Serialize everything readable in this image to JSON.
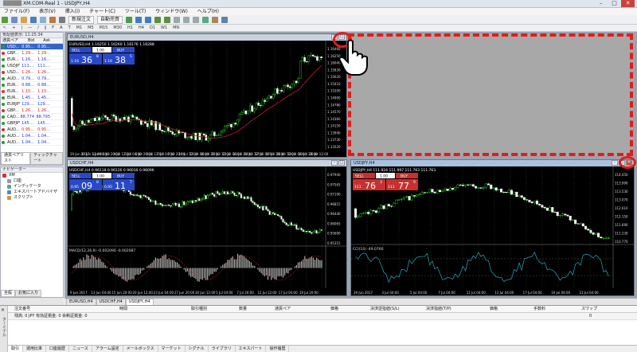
{
  "window": {
    "title": "XM.COM-Real 1 - USDJPY,H4",
    "title_blur": "█████ "
  },
  "menu": [
    "ファイル(F)",
    "表示(V)",
    "挿入(I)",
    "チャート(C)",
    "ツール(T)",
    "ウィンドウ(W)",
    "ヘルプ(H)"
  ],
  "toolbar": {
    "new_order": "新規注文",
    "auto_trade": "自動売買"
  },
  "timeframes": [
    "M1",
    "M5",
    "M15",
    "M30",
    "H1",
    "H4",
    "D1",
    "W1",
    "MN"
  ],
  "market_watch": {
    "title": "気配値表示: 11:25:34",
    "columns": [
      "通貨ペア",
      "Bid",
      "Ask"
    ],
    "rows": [
      {
        "sym": "USD...",
        "bid": "0.95...",
        "ask": "0.95..."
      },
      {
        "sym": "GBP...",
        "bid": "1.29...",
        "ask": "1.29..."
      },
      {
        "sym": "EUR...",
        "bid": "1.16...",
        "ask": "1.16..."
      },
      {
        "sym": "USDJPY",
        "bid": "111....",
        "ask": "111...."
      },
      {
        "sym": "USD...",
        "bid": "1.26...",
        "ask": "1.26..."
      },
      {
        "sym": "AUD...",
        "bid": "0.79...",
        "ask": "0.79..."
      },
      {
        "sym": "EUR...",
        "bid": "0.88...",
        "ask": "0.88..."
      },
      {
        "sym": "EUR...",
        "bid": "1.10...",
        "ask": "1.10..."
      },
      {
        "sym": "EUR...",
        "bid": "1.45...",
        "ask": "1.45..."
      },
      {
        "sym": "EURJPY",
        "bid": "129....",
        "ask": "129...."
      },
      {
        "sym": "GBP...",
        "bid": "1.26...",
        "ask": "1.26..."
      },
      {
        "sym": "CAD...",
        "bid": "88.774",
        "ask": "88.795"
      },
      {
        "sym": "GBPJPY",
        "bid": "145....",
        "ask": "145...."
      },
      {
        "sym": "AUD...",
        "bid": "0.95...",
        "ask": "0.95..."
      },
      {
        "sym": "AUD...",
        "bid": "1.04...",
        "ask": "1.04..."
      },
      {
        "sym": "AUD...",
        "bid": "1.04...",
        "ask": "1.04..."
      }
    ],
    "tabs": [
      "通貨ペアリスト",
      "ティックチャート"
    ]
  },
  "navigator": {
    "title": "ナビゲーター",
    "items": [
      "XM",
      "口座",
      "インディケータ",
      "エキスパートアドバイザ",
      "スクリプト"
    ],
    "tabs": [
      "全般",
      "お気に入り"
    ]
  },
  "charts": {
    "eurusd": {
      "title": "EURUSD,H4",
      "info": "EURUSD,H4  1.16250 1.16260 1.16176 1.16288",
      "sell": "SELL",
      "buy": "BUY",
      "lot": "1.00",
      "bid_pre": "1.16",
      "bid_big": "36",
      "bid_sup": "8",
      "ask_pre": "1.16",
      "ask_big": "38",
      "ask_sup": "5",
      "xlabels": [
        "29 Jun 2017",
        "30 Jun 12:00",
        "3 Jul 04:00",
        "3 Jul 20:00",
        "4 Jul 12:00",
        "5 Jul 04:00",
        "5 Jul 20:00",
        "6 Jul 12:00",
        "7 Jul 04:00",
        "7 Jul 20:00",
        "10 Jul 12:00",
        "11 Jul 04:00",
        "11 Jul 20:00",
        "12 Jul 12:00",
        "13 Jul 04:00",
        "13 Jul 20:00",
        "14 Jul 12:00",
        "17 Jul 04:00",
        "17 Jul 20:00",
        "18 Jul 12:00",
        "19 Jul 04:00",
        "19 Jul 20:00",
        "20 Jul 12:00"
      ],
      "ylabels": [
        "1.16460",
        "1.16250",
        "1.16040",
        "1.15830",
        "1.15620",
        "1.15410",
        "1.15200",
        "1.14990",
        "1.14780",
        "1.14570",
        "1.14360",
        "1.14150",
        "1.13940",
        "1.13730",
        "1.13520"
      ]
    },
    "usdchf": {
      "title": "USDCHF,H4",
      "info": "USDCHF,H4  0.96118 0.96126 0.96030 0.96096",
      "sell": "SELL",
      "buy": "BUY",
      "lot": "1.00",
      "bid_pre": "0.95",
      "bid_big": "09",
      "bid_sup": "8",
      "ask_pre": "0.95",
      "ask_big": "11",
      "ask_sup": "7",
      "macd": "MACD(12,26,9) -0.002090 -0.002087",
      "xlabels": [
        "9 Jun 2017",
        "13 Jun 04:00",
        "15 Jun 20:00",
        "20 Jun 12:00",
        "23 Jun 04:00",
        "27 Jun 20:00",
        "30 Jun 12:00",
        "5 Jul 04:00",
        "7 Jul 20:00",
        "12 Jul 12:00",
        "17 Jul 04:00",
        "19 Jul 20:00"
      ],
      "ylabels": [
        "0.97940",
        "0.97565",
        "0.97190",
        "0.96815",
        "0.96440",
        "0.96065",
        "0.95690",
        "0.95315"
      ]
    },
    "usdjpy": {
      "title": "USDJPY,H4",
      "info": "USDJPY,H4  111.924 111.997 111.763 111.763",
      "sell": "SELL",
      "buy": "BUY",
      "lot": "1.00",
      "bid_pre": "111",
      "bid_big": "76",
      "bid_sup": "3",
      "ask_pre": "111",
      "ask_big": "77",
      "ask_sup": "9",
      "cci": "CCI(14) -49.0760",
      "xlabels": [
        "29 Jun 2017",
        "3 Jul 04:00",
        "5 Jul 04:00",
        "7 Jul 04:00",
        "11 Jul 04:00",
        "13 Jul 04:00",
        "17 Jul 04:00",
        "19 Jul 04:00",
        "21 Jul 04:00"
      ],
      "ylabels": [
        "114.450",
        "113.990",
        "113.530",
        "113.070",
        "112.610",
        "112.150",
        "111.690",
        "111.230",
        "110.770"
      ]
    }
  },
  "chart_tabs": [
    "EURUSD,H4",
    "USDCHF,H4",
    "USDJPY,H4"
  ],
  "terminal": {
    "columns": [
      "注文番号",
      "時間",
      "取引種別",
      "数量",
      "通貨ペア",
      "価格",
      "決済逆指値(S/L)",
      "決済指値(T/P)",
      "価格",
      "手数料",
      "スワップ"
    ],
    "balance_line": "残高: 0 JPY  有効証拠金: 0  余剰証拠金: 0",
    "balance_value": "0",
    "tabs": [
      "取引",
      "運用比率",
      "口座履歴",
      "ニュース",
      "アラーム設定",
      "メールボックス",
      "マーケット",
      "シグナル",
      "ライブラリ",
      "エキスパート",
      "操作履歴"
    ],
    "side_label": "ターミナル"
  }
}
